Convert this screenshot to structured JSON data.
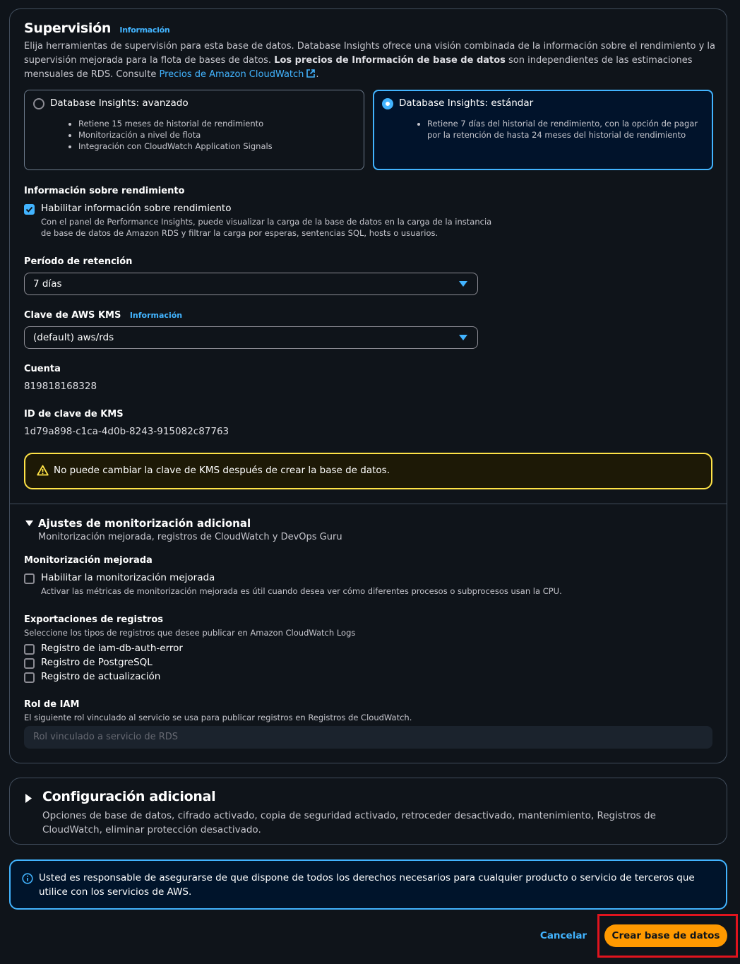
{
  "monitoring": {
    "title": "Supervisión",
    "info_link": "Información",
    "description_1": "Elija herramientas de supervisión para esta base de datos. Database Insights ofrece una visión combinada de la información sobre el rendimiento y la supervisión mejorada para la flota de bases de datos. ",
    "description_bold": "Los precios de Información de base de datos",
    "description_2": " son independientes de las estimaciones mensuales de RDS. Consulte ",
    "pricing_link": "Precios de Amazon CloudWatch",
    "description_end": ".",
    "tiles": [
      {
        "title": "Database Insights: avanzado",
        "selected": false,
        "bullets": [
          "Retiene 15 meses de historial de rendimiento",
          "Monitorización a nivel de flota",
          "Integración con CloudWatch Application Signals"
        ]
      },
      {
        "title": "Database Insights: estándar",
        "selected": true,
        "bullets": [
          "Retiene 7 días del historial de rendimiento, con la opción de pagar por la retención de hasta 24 meses del historial de rendimiento"
        ]
      }
    ],
    "perf_insights": {
      "label": "Información sobre rendimiento",
      "checkbox_label": "Habilitar información sobre rendimiento",
      "checked": true,
      "description": "Con el panel de Performance Insights, puede visualizar la carga de la base de datos en la carga de la instancia de base de datos de Amazon RDS y filtrar la carga por esperas, sentencias SQL, hosts o usuarios."
    },
    "retention": {
      "label": "Período de retención",
      "value": "7 días"
    },
    "kms": {
      "label": "Clave de AWS KMS",
      "info_link": "Información",
      "value": "(default) aws/rds"
    },
    "account": {
      "label": "Cuenta",
      "value": "819818168328"
    },
    "kms_id": {
      "label": "ID de clave de KMS",
      "value": "1d79a898-c1ca-4d0b-8243-915082c87763"
    },
    "warning": "No puede cambiar la clave de KMS después de crear la base de datos.",
    "additional": {
      "title": "Ajustes de monitorización adicional",
      "subtitle": "Monitorización mejorada, registros de CloudWatch y DevOps Guru",
      "enhanced": {
        "label": "Monitorización mejorada",
        "checkbox_label": "Habilitar la monitorización mejorada",
        "checked": false,
        "description": "Activar las métricas de monitorización mejorada es útil cuando desea ver cómo diferentes procesos o subprocesos usan la CPU."
      },
      "exports": {
        "label": "Exportaciones de registros",
        "description": "Seleccione los tipos de registros que desee publicar en Amazon CloudWatch Logs",
        "options": [
          {
            "label": "Registro de iam-db-auth-error",
            "checked": false
          },
          {
            "label": "Registro de PostgreSQL",
            "checked": false
          },
          {
            "label": "Registro de actualización",
            "checked": false
          }
        ]
      },
      "iam_role": {
        "label": "Rol de IAM",
        "description": "El siguiente rol vinculado al servicio se usa para publicar registros en Registros de CloudWatch.",
        "placeholder": "Rol vinculado a servicio de RDS"
      }
    }
  },
  "config": {
    "title": "Configuración adicional",
    "subtitle": "Opciones de base de datos, cifrado activado, copia de seguridad activado, retroceder desactivado, mantenimiento, Registros de CloudWatch, eliminar protección desactivado."
  },
  "info_alert": "Usted es responsable de asegurarse de que dispone de todos los derechos necesarios para cualquier producto o servicio de terceros que utilice con los servicios de AWS.",
  "actions": {
    "cancel": "Cancelar",
    "create": "Crear base de datos"
  },
  "colors": {
    "accent": "#42b4ff",
    "primary_button": "#ff9900",
    "warning_border": "#ffe347",
    "highlight": "#e0141e"
  }
}
